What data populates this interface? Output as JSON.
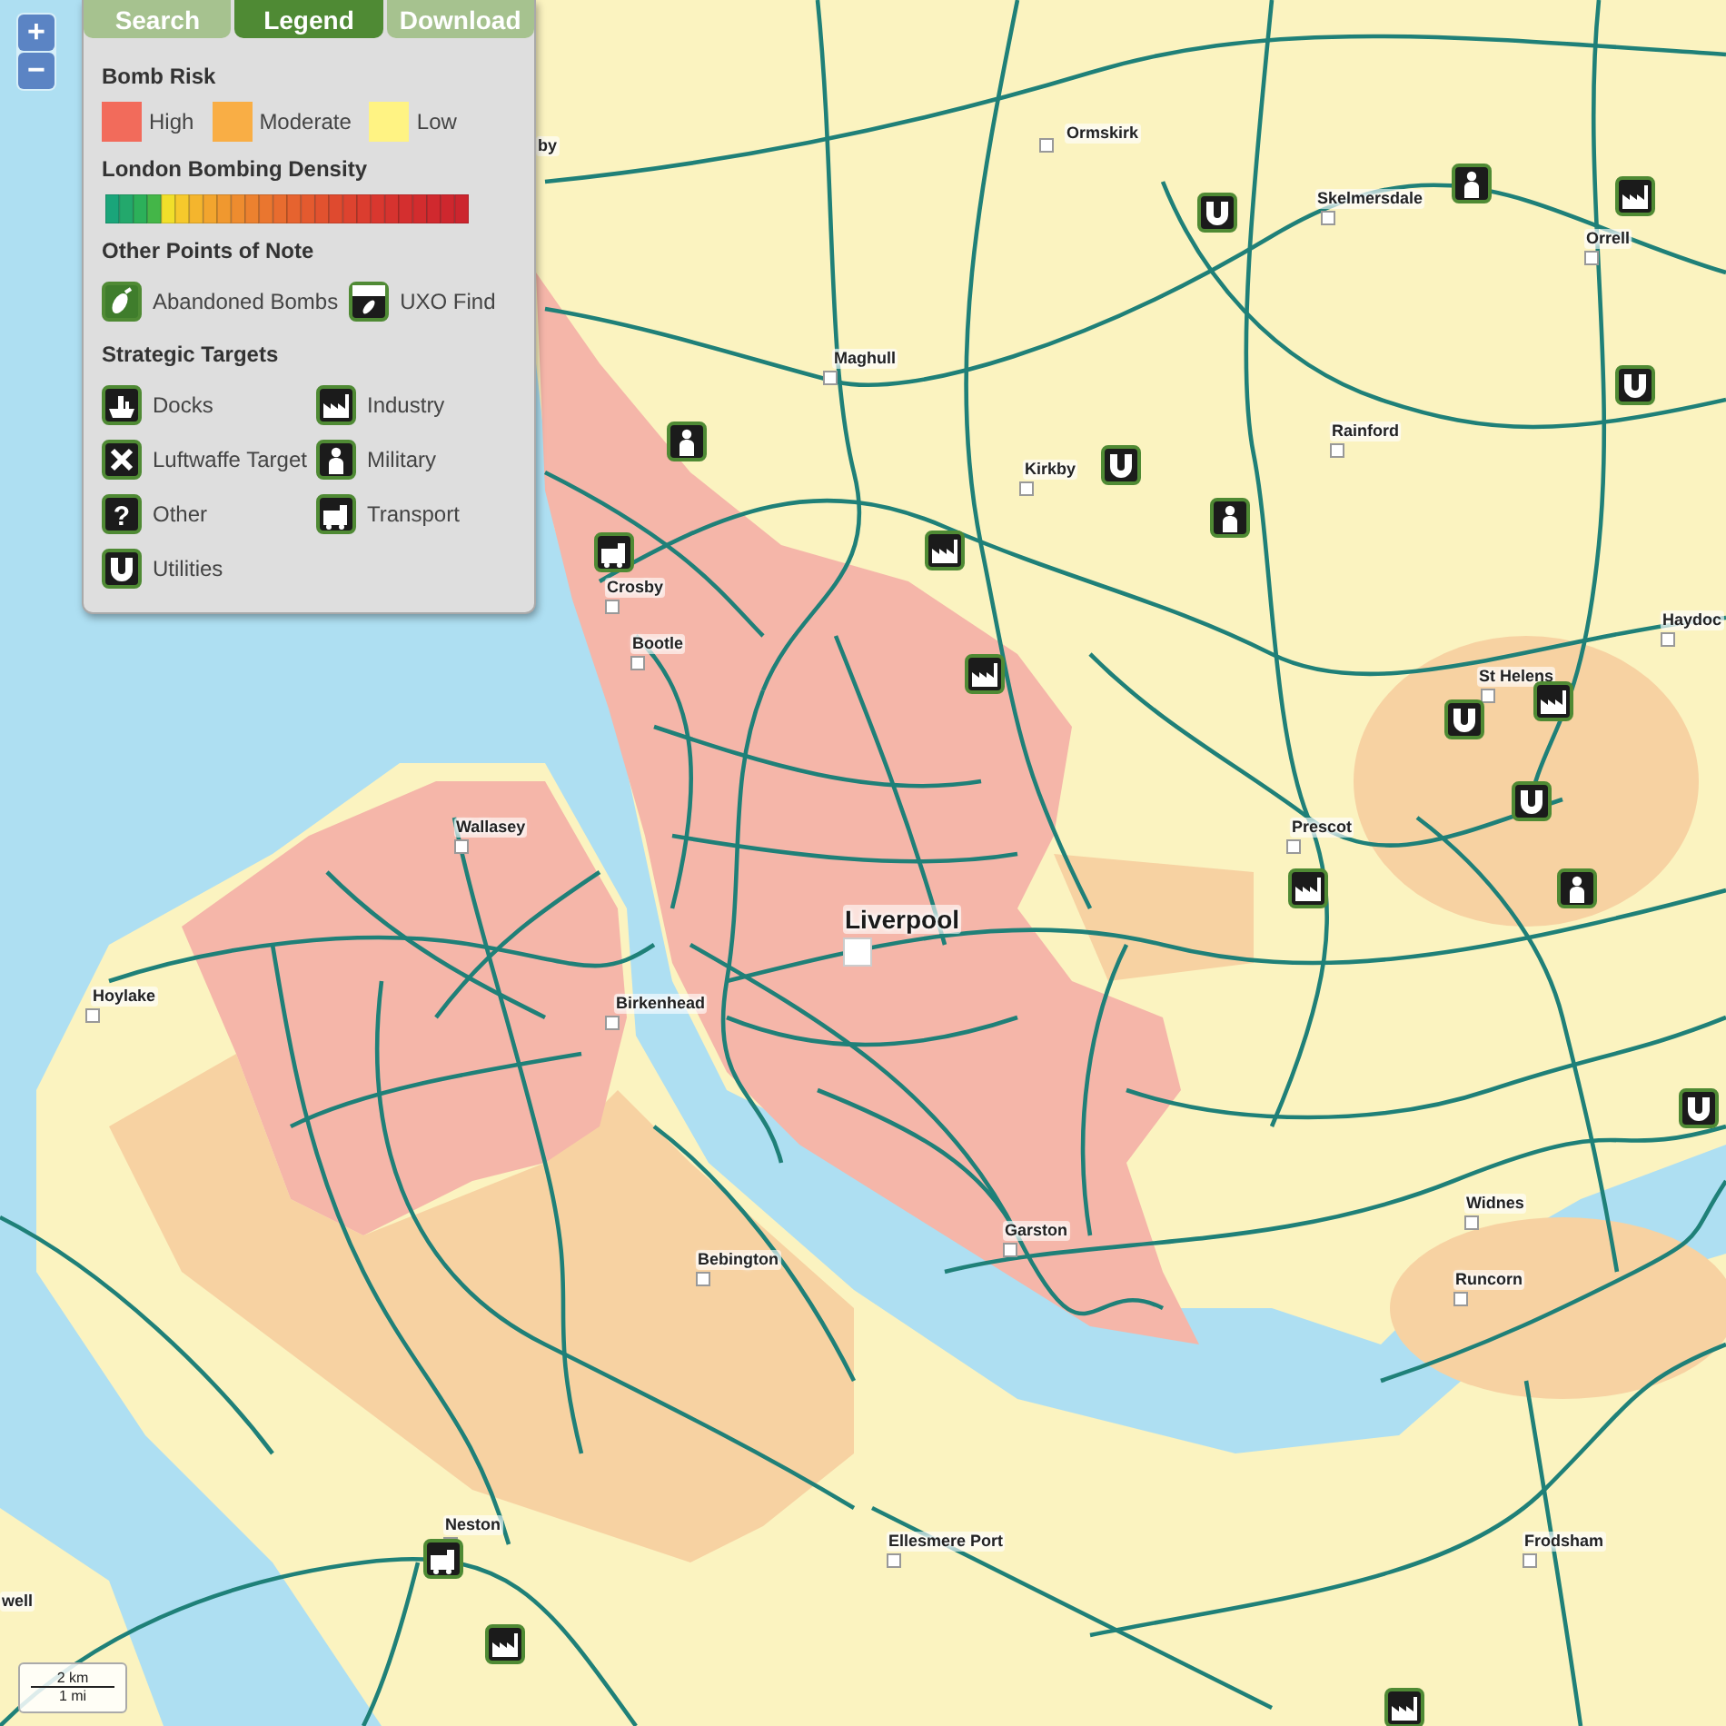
{
  "map_controls": {
    "zoom_in": "+",
    "zoom_out": "−"
  },
  "tabs": [
    {
      "label": "Search",
      "selected": false
    },
    {
      "label": "Legend",
      "selected": true
    },
    {
      "label": "Download",
      "selected": false
    }
  ],
  "legend": {
    "bomb_risk": {
      "title": "Bomb Risk",
      "items": [
        {
          "label": "High",
          "color": "#f26b5b"
        },
        {
          "label": "Moderate",
          "color": "#f9ae45"
        },
        {
          "label": "Low",
          "color": "#fff383"
        }
      ]
    },
    "density": {
      "title": "London Bombing Density"
    },
    "points_of_note": {
      "title": "Other Points of Note",
      "items": [
        {
          "label": "Abandoned Bombs",
          "kind": "abandoned"
        },
        {
          "label": "UXO Find",
          "kind": "uxo"
        }
      ]
    },
    "strategic_targets": {
      "title": "Strategic Targets",
      "items": [
        {
          "label": "Docks",
          "kind": "docks"
        },
        {
          "label": "Industry",
          "kind": "industry"
        },
        {
          "label": "Luftwaffe Target",
          "kind": "luftwaffe"
        },
        {
          "label": "Military",
          "kind": "military"
        },
        {
          "label": "Other",
          "kind": "other",
          "symbol": "?"
        },
        {
          "label": "Transport",
          "kind": "transport"
        },
        {
          "label": "Utilities",
          "kind": "utilities"
        }
      ]
    }
  },
  "map": {
    "towns": [
      {
        "name": "by",
        "kind": "town"
      },
      {
        "name": "Ormskirk",
        "kind": "town"
      },
      {
        "name": "Skelmersdale",
        "kind": "town"
      },
      {
        "name": "Orrell",
        "kind": "town"
      },
      {
        "name": "Maghull",
        "kind": "town"
      },
      {
        "name": "Rainford",
        "kind": "town"
      },
      {
        "name": "Kirkby",
        "kind": "town"
      },
      {
        "name": "Crosby",
        "kind": "town"
      },
      {
        "name": "Bootle",
        "kind": "town"
      },
      {
        "name": "Haydoc",
        "kind": "town"
      },
      {
        "name": "St Helens",
        "kind": "town"
      },
      {
        "name": "Prescot",
        "kind": "town"
      },
      {
        "name": "Wallasey",
        "kind": "town"
      },
      {
        "name": "Liverpool",
        "kind": "city"
      },
      {
        "name": "Hoylake",
        "kind": "town"
      },
      {
        "name": "Birkenhead",
        "kind": "town"
      },
      {
        "name": "Widnes",
        "kind": "town"
      },
      {
        "name": "Runcorn",
        "kind": "town"
      },
      {
        "name": "Garston",
        "kind": "town"
      },
      {
        "name": "Bebington",
        "kind": "town"
      },
      {
        "name": "Neston",
        "kind": "town"
      },
      {
        "name": "Ellesmere Port",
        "kind": "town"
      },
      {
        "name": "Frodsham",
        "kind": "town"
      },
      {
        "name": "well",
        "kind": "town"
      }
    ],
    "markers": [
      {
        "kind": "utilities"
      },
      {
        "kind": "military"
      },
      {
        "kind": "industry"
      },
      {
        "kind": "utilities"
      },
      {
        "kind": "military"
      },
      {
        "kind": "utilities"
      },
      {
        "kind": "military"
      },
      {
        "kind": "industry"
      },
      {
        "kind": "transport"
      },
      {
        "kind": "industry"
      },
      {
        "kind": "utilities"
      },
      {
        "kind": "industry"
      },
      {
        "kind": "utilities"
      },
      {
        "kind": "military"
      },
      {
        "kind": "industry"
      },
      {
        "kind": "utilities"
      },
      {
        "kind": "transport"
      },
      {
        "kind": "industry"
      },
      {
        "kind": "industry"
      }
    ],
    "scale": {
      "primary": "2 km",
      "secondary": "1 mi"
    }
  }
}
